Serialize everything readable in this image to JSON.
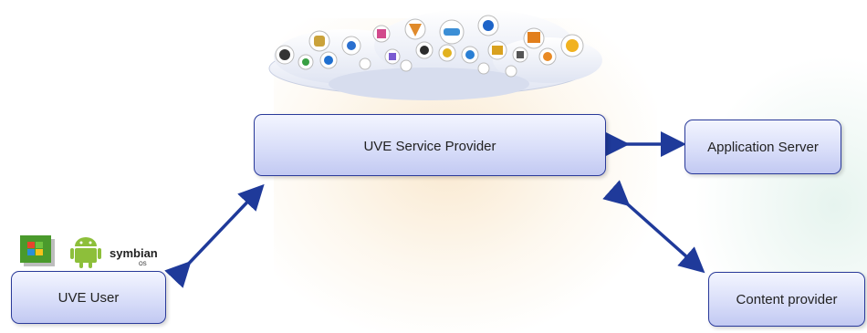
{
  "nodes": {
    "service_provider": "UVE Service Provider",
    "application_server": "Application Server",
    "uve_user": "UVE User",
    "content_provider": "Content provider"
  },
  "os_logos": {
    "windows": "windows-logo-icon",
    "android": "android-logo-icon",
    "symbian": "symbian",
    "symbian_sub": "OS"
  },
  "colors": {
    "arrow": "#1f3a9a",
    "box_border": "#2a3a9a",
    "box_fill_top": "#f3f5ff",
    "box_fill_bottom": "#c2c9f2"
  }
}
